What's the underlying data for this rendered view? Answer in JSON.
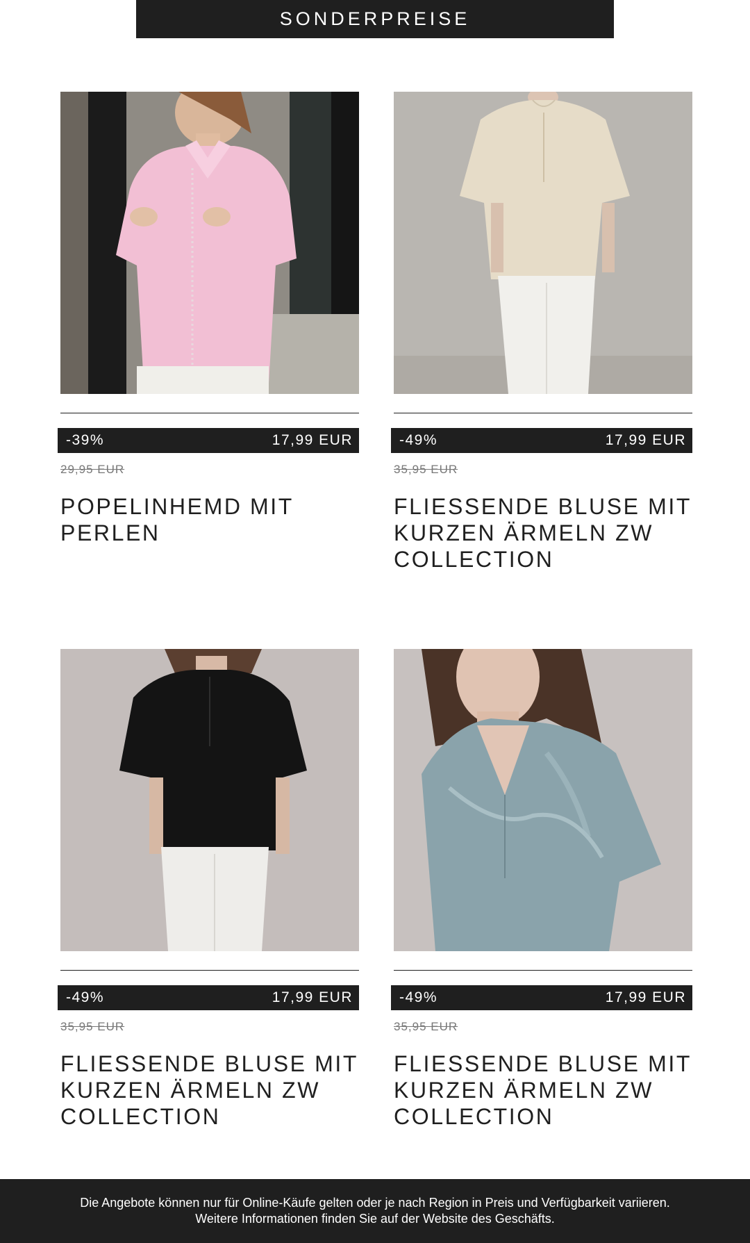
{
  "header": {
    "banner_title": "SONDERPREISE"
  },
  "products": [
    {
      "discount": "-39%",
      "price": "17,99 EUR",
      "old_price": "29,95 EUR",
      "title": "POPELINHEMD MIT PERLEN",
      "image": "pink-pearl-shirt-photo"
    },
    {
      "discount": "-49%",
      "price": "17,99 EUR",
      "old_price": "35,95 EUR",
      "title": "FLIESSENDE BLUSE MIT KURZEN ÄRMELN ZW COLLECTION",
      "image": "cream-blouse-photo"
    },
    {
      "discount": "-49%",
      "price": "17,99 EUR",
      "old_price": "35,95 EUR",
      "title": "FLIESSENDE BLUSE MIT KURZEN ÄRMELN ZW COLLECTION",
      "image": "black-blouse-photo"
    },
    {
      "discount": "-49%",
      "price": "17,99 EUR",
      "old_price": "35,95 EUR",
      "title": "FLIESSENDE BLUSE MIT KURZEN ÄRMELN ZW COLLECTION",
      "image": "blue-satin-blouse-photo"
    }
  ],
  "footer": {
    "line1": "Die Angebote können nur für Online-Käufe gelten oder je nach Region in Preis und Verfügbarkeit variieren.",
    "line2": "Weitere Informationen finden Sie auf der Website des Geschäfts."
  },
  "colors": {
    "dark": "#1f1f1f",
    "background": "#ffffff",
    "muted_text": "#777777"
  }
}
